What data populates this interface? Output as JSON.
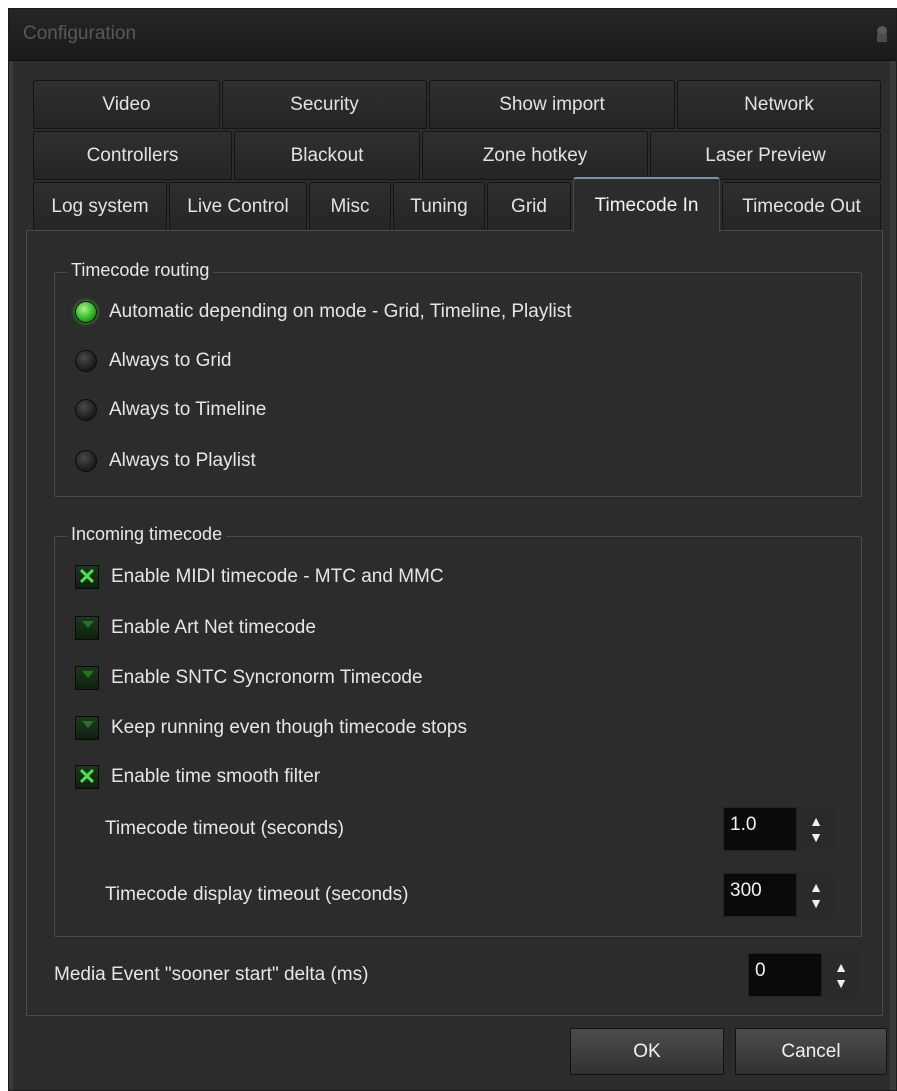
{
  "window": {
    "title": "Configuration"
  },
  "tabs": {
    "row1": [
      "Video",
      "Security",
      "Show import",
      "Network"
    ],
    "row2": [
      "Controllers",
      "Blackout",
      "Zone hotkey",
      "Laser Preview"
    ],
    "row3": [
      "Log system",
      "Live Control",
      "Misc",
      "Tuning",
      "Grid",
      "Timecode In",
      "Timecode Out"
    ],
    "active": "Timecode In"
  },
  "routing": {
    "title": "Timecode routing",
    "options": [
      {
        "label": "Automatic depending on mode - Grid, Timeline, Playlist",
        "selected": true
      },
      {
        "label": "Always to Grid",
        "selected": false
      },
      {
        "label": "Always to Timeline",
        "selected": false
      },
      {
        "label": "Always to Playlist",
        "selected": false
      }
    ]
  },
  "incoming": {
    "title": "Incoming timecode",
    "checks": [
      {
        "label": "Enable MIDI timecode - MTC and MMC",
        "checked": true
      },
      {
        "label": "Enable Art Net timecode",
        "checked": false
      },
      {
        "label": "Enable SNTC Syncronorm Timecode",
        "checked": false
      },
      {
        "label": "Keep running even though timecode stops",
        "checked": false
      },
      {
        "label": "Enable time smooth filter",
        "checked": true
      }
    ],
    "timeout_label": "Timecode timeout (seconds)",
    "timeout_value": "1.0",
    "display_timeout_label": "Timecode display timeout (seconds)",
    "display_timeout_value": "300"
  },
  "media_event": {
    "label": "Media Event \"sooner start\" delta (ms)",
    "value": "0"
  },
  "buttons": {
    "ok": "OK",
    "cancel": "Cancel"
  },
  "icons": {
    "title_corner": "pin-icon",
    "check_mark": "x-mark-icon",
    "spin": "spinner-arrows-icon"
  },
  "colors": {
    "radio_on": "#3fd02a",
    "check_mark": "#4fe04f",
    "background": "#2c2c2c"
  }
}
